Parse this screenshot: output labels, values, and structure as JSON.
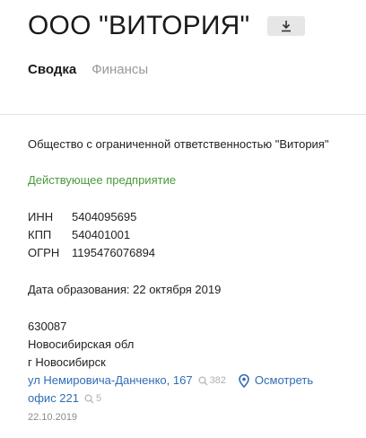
{
  "header": {
    "title": "ООО \"ВИТОРИЯ\"",
    "download_icon": "download-icon"
  },
  "tabs": [
    {
      "label": "Сводка",
      "active": true
    },
    {
      "label": "Финансы",
      "active": false
    }
  ],
  "summary": {
    "full_name": "Общество с ограниченной ответственностью \"Витория\"",
    "status": "Действующее предприятие",
    "status_color": "#4a9a3c",
    "identifiers": [
      {
        "label": "ИНН",
        "value": "5404095695"
      },
      {
        "label": "КПП",
        "value": "540401001"
      },
      {
        "label": "ОГРН",
        "value": "1195476076894"
      }
    ],
    "founded": "Дата образования: 22 октября 2019",
    "address": {
      "postal_code": "630087",
      "region": "Новосибирская обл",
      "city": "г Новосибирск",
      "street": "ул Немировича-Данченко, 167",
      "street_count": "382",
      "map_link": "Осмотреть",
      "office": "офис 221",
      "office_count": "5",
      "date": "22.10.2019"
    }
  },
  "colors": {
    "link": "#2f6db5",
    "muted": "#999999"
  }
}
